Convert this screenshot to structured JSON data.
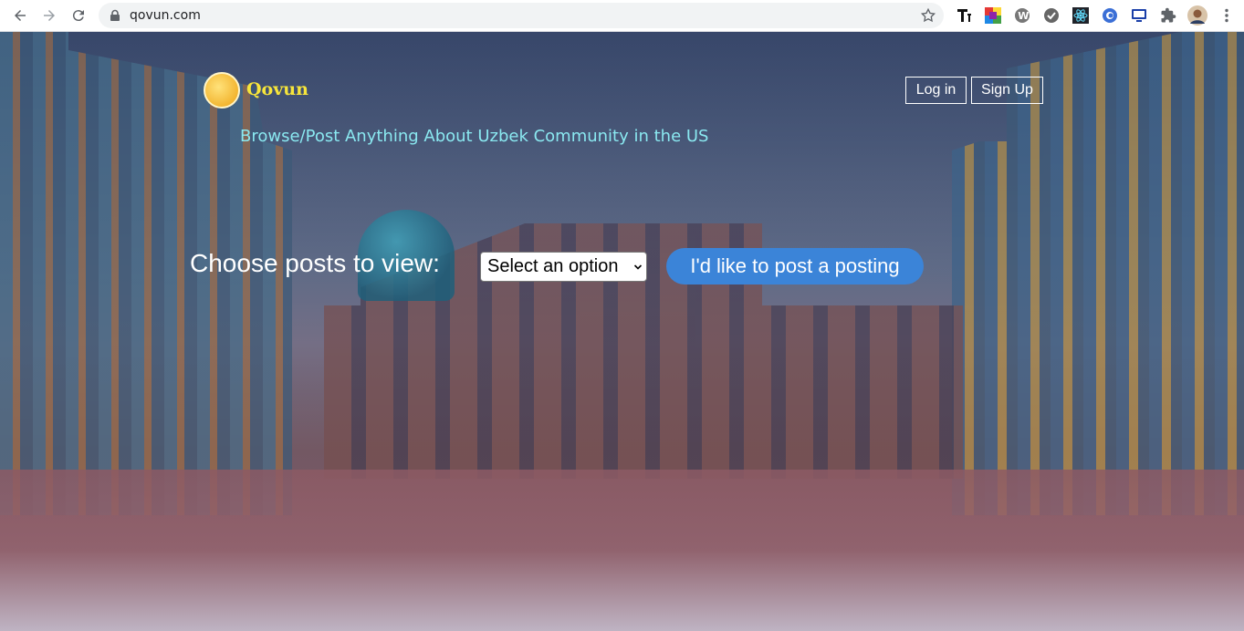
{
  "browser": {
    "url": "qovun.com"
  },
  "site": {
    "brand": "Qovun",
    "tagline": "Browse/Post Anything About Uzbek Community in the US",
    "login_label": "Log in",
    "signup_label": "Sign Up"
  },
  "main": {
    "choose_label": "Choose posts to view:",
    "select_value": "Select an option",
    "post_button_label": "I'd like to post a posting"
  },
  "colors": {
    "brand": "#f7e53b",
    "tagline": "#8ae8f0",
    "post_button": "#3b84d8"
  },
  "icons": [
    "back-icon",
    "forward-icon",
    "reload-icon",
    "lock-icon",
    "star-icon",
    "extensions-icon",
    "profile-avatar",
    "menu-icon"
  ]
}
